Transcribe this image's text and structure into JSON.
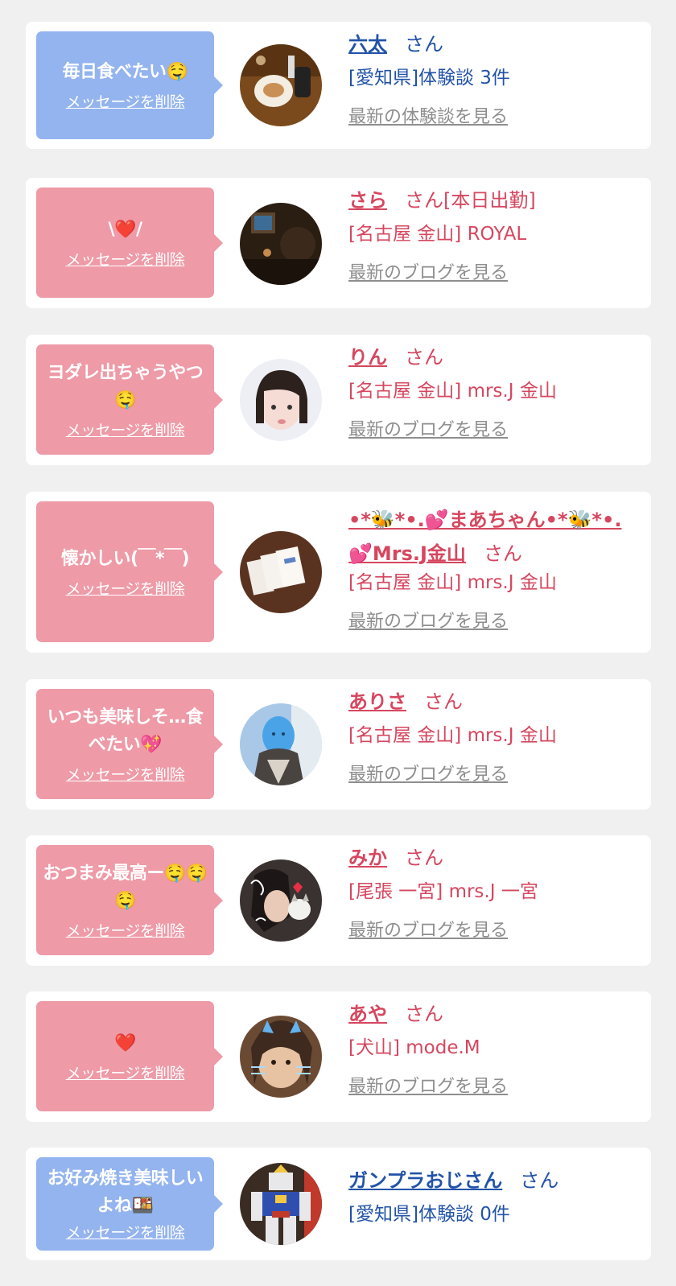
{
  "colors": {
    "background": "#f0f0f0",
    "card": "#ffffff",
    "bubble_blue": "#93b4ee",
    "bubble_pink": "#ee9aa7",
    "text_blue": "#2253a8",
    "text_pink": "#d6475f",
    "link_gray": "#8e8e8e"
  },
  "items": [
    {
      "message": "毎日食べたい🤤",
      "message_emoji": "drooling-face",
      "delete_label": "メッセージを削除",
      "name": "六太",
      "suffix": "さん",
      "detail": "[愛知県]体験談 3件",
      "link": "最新の体験談を見る",
      "theme": "blue",
      "avatar_icon": "food-plate-photo"
    },
    {
      "message": "\\❤️/",
      "message_emoji": "heart",
      "delete_label": "メッセージを削除",
      "name": "さら",
      "suffix": "さん[本日出勤]",
      "detail": "[名古屋 金山] ROYAL",
      "link": "最新のブログを見る",
      "theme": "pink",
      "avatar_icon": "dark-room-photo"
    },
    {
      "message": "ヨダレ出ちゃうやつ🤤",
      "message_emoji": "drooling-face",
      "delete_label": "メッセージを削除",
      "name": "りん",
      "suffix": "さん",
      "detail": "[名古屋 金山] mrs.J 金山",
      "link": "最新のブログを見る",
      "theme": "pink",
      "avatar_icon": "woman-portrait"
    },
    {
      "message": "懐かしい(￣*￣)",
      "delete_label": "メッセージを削除",
      "name": "•*🐝*•.💕まあちゃん•*🐝*•.💕Mrs.J金山",
      "suffix": "さん",
      "detail": "[名古屋 金山] mrs.J 金山",
      "link": "最新のブログを見る",
      "theme": "pink",
      "avatar_icon": "cards-photo"
    },
    {
      "message": "いつも美味しそ…食べたい💖",
      "message_emoji": "sparkling-heart",
      "delete_label": "メッセージを削除",
      "name": "ありさ",
      "suffix": "さん",
      "detail": "[名古屋 金山] mrs.J 金山",
      "link": "最新のブログを見る",
      "theme": "pink",
      "avatar_icon": "woman-portrait-masked"
    },
    {
      "message": "おつまみ最高ー🤤🤤🤤",
      "message_emoji": "drooling-face",
      "delete_label": "メッセージを削除",
      "name": "みか",
      "suffix": "さん",
      "detail": "[尾張 一宮] mrs.J 一宮",
      "link": "最新のブログを見る",
      "theme": "pink",
      "avatar_icon": "woman-with-cat-sticker"
    },
    {
      "message": "❤️",
      "message_emoji": "heart",
      "delete_label": "メッセージを削除",
      "name": "あや",
      "suffix": "さん",
      "detail": "[犬山] mode.M",
      "link": "最新のブログを見る",
      "theme": "pink",
      "avatar_icon": "woman-with-cat-filter"
    },
    {
      "message": "お好み焼き美味しいよね🍱",
      "message_emoji": "bento",
      "delete_label": "メッセージを削除",
      "name": "ガンプラおじさん",
      "suffix": "さん",
      "detail": "[愛知県]体験談 0件",
      "theme": "blue",
      "avatar_icon": "robot-model-photo"
    }
  ]
}
